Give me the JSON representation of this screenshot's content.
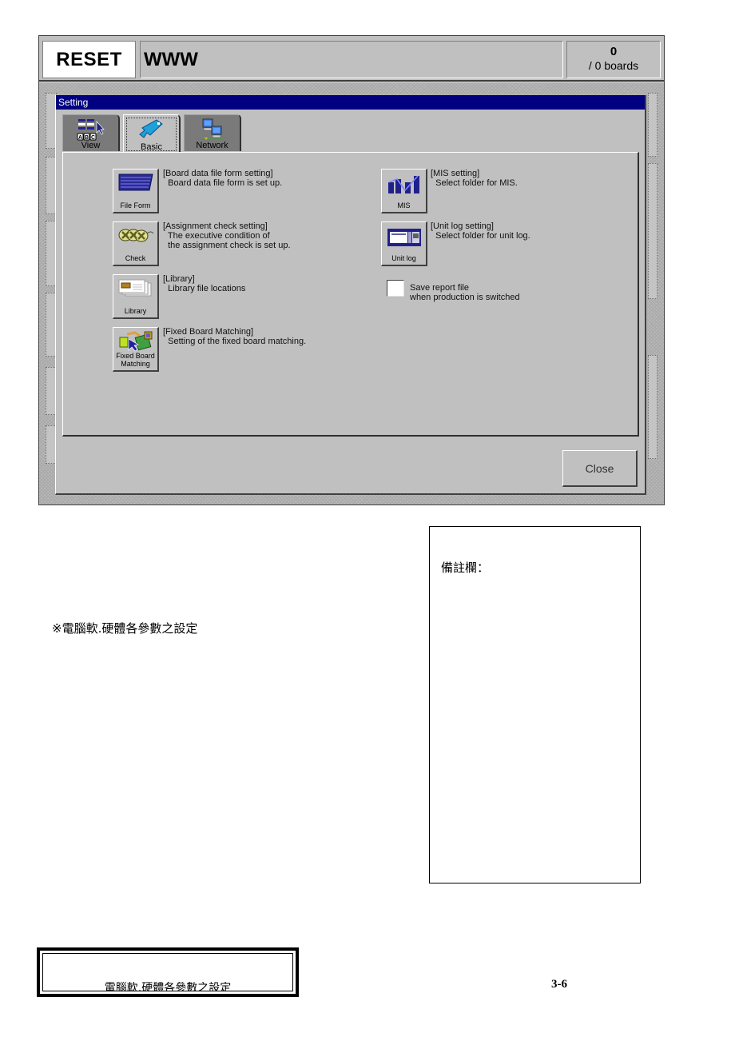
{
  "topbar": {
    "reset_label": "RESET",
    "production_name": "WWW",
    "counter_value": "0",
    "counter_total": "/ 0 boards"
  },
  "dialog": {
    "title": "Setting",
    "tabs": [
      {
        "label": "View",
        "icon": "view-abc-icon",
        "active": false
      },
      {
        "label": "Basic",
        "icon": "basic-wrench-icon",
        "active": true
      },
      {
        "label": "Network",
        "icon": "network-computers-icon",
        "active": false
      }
    ],
    "options": [
      {
        "button_label": "File Form",
        "icon": "file-form-icon",
        "title": "[Board data file form setting]",
        "description": "  Board data file form is set up."
      },
      {
        "button_label": "Check",
        "icon": "check-chain-icon",
        "title": "[Assignment check setting]",
        "description": "  The executive condition of\n  the assignment check is set up."
      },
      {
        "button_label": "Library",
        "icon": "library-cards-icon",
        "title": "[Library]",
        "description": "  Library file locations"
      },
      {
        "button_label": "Fixed Board Matching",
        "icon": "fixed-board-matching-icon",
        "title": "[Fixed Board Matching]",
        "description": "  Setting of the fixed board matching."
      },
      {
        "button_label": "MIS",
        "icon": "mis-chart-icon",
        "title": "[MIS setting]",
        "description": "  Select folder for MIS."
      },
      {
        "button_label": "Unit log",
        "icon": "unit-log-icon",
        "title": "[Unit log setting]",
        "description": "  Select folder for unit log."
      }
    ],
    "save_report": {
      "checked": false,
      "label": "Save report file\nwhen production is switched"
    },
    "close_label": "Close"
  },
  "document": {
    "note": "※電腦軟.硬體各參數之設定",
    "remark_label": "備註欄：",
    "footer_title": "電腦軟.硬體各參數之設定",
    "page_number": "3-6"
  }
}
